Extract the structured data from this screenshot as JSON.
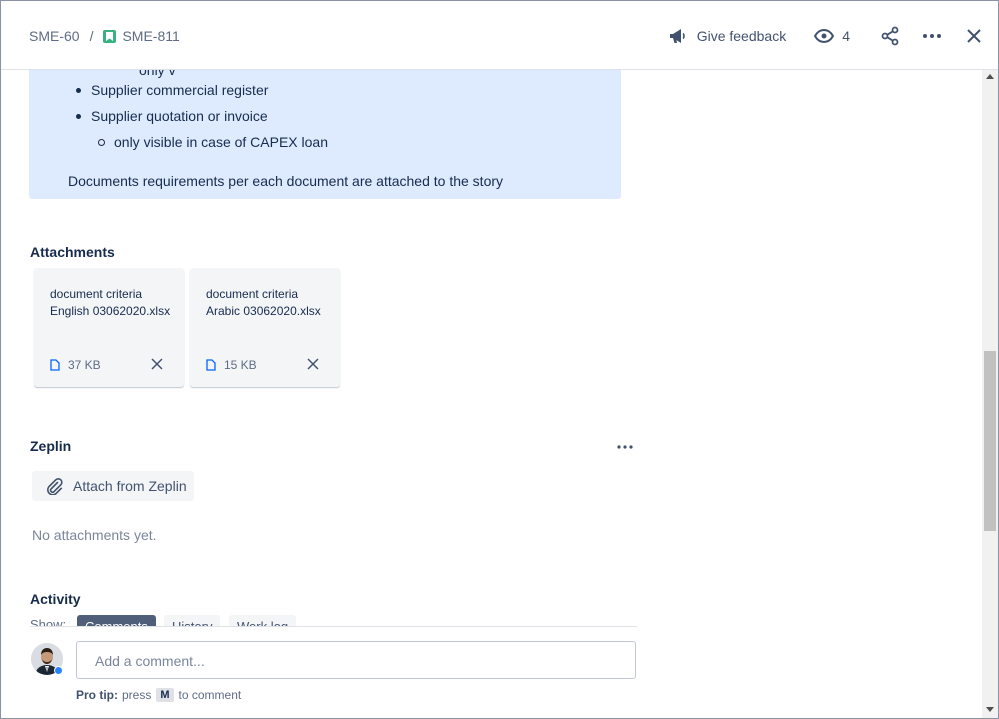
{
  "header": {
    "parent_key": "SME-60",
    "separator": "/",
    "issue_key": "SME-811",
    "feedback_label": "Give feedback",
    "watchers_count": "4"
  },
  "description": {
    "cut_item": "only v",
    "items": [
      "Supplier commercial register",
      "Supplier quotation or invoice"
    ],
    "sub_item": "only visible in case of CAPEX loan",
    "note": "Documents requirements per each document are attached to the story"
  },
  "attachments": {
    "title": "Attachments",
    "files": [
      {
        "name": "document criteria English 03062020.xlsx",
        "size": "37 KB"
      },
      {
        "name": "document criteria Arabic 03062020.xlsx",
        "size": "15 KB"
      }
    ]
  },
  "zeplin": {
    "title": "Zeplin",
    "attach_label": "Attach from Zeplin",
    "empty_text": "No attachments yet."
  },
  "activity": {
    "title": "Activity",
    "show_label": "Show:",
    "tabs": [
      "Comments",
      "History",
      "Work log"
    ],
    "comment_placeholder": "Add a comment...",
    "protip_bold": "Pro tip:",
    "protip_press": "press",
    "protip_key": "M",
    "protip_rest": "to comment"
  },
  "colors": {
    "panel_bg": "#deebff",
    "story_green": "#36b37e",
    "active_tab": "#505f79"
  }
}
